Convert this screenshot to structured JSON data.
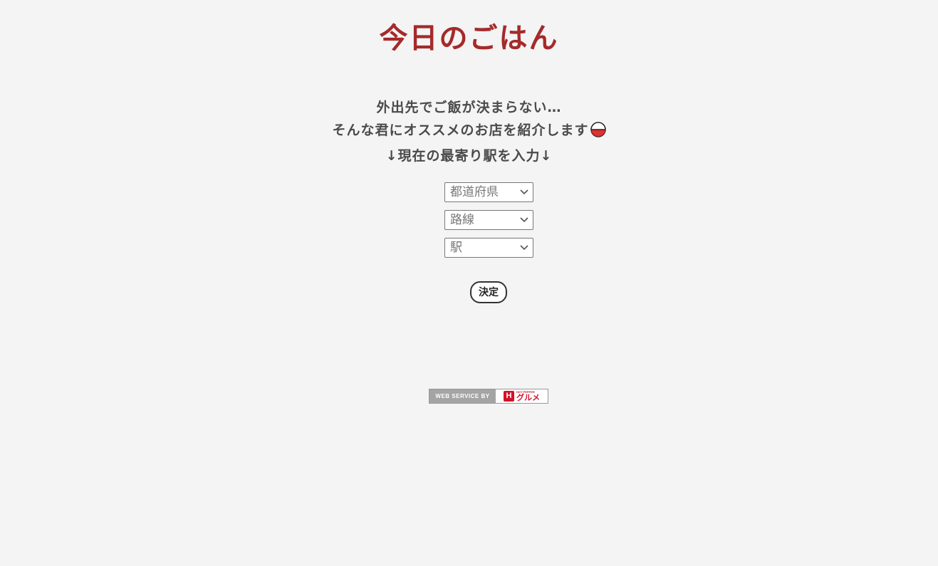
{
  "header": {
    "title": "今日のごはん"
  },
  "intro": {
    "line1": "外出先でご飯が決まらない…",
    "line2": "そんな君にオススメのお店を紹介します",
    "line3": "↓現在の最寄り駅を入力↓"
  },
  "form": {
    "prefecture_placeholder": "都道府県",
    "line_placeholder": "路線",
    "station_placeholder": "駅",
    "submit_label": "決定"
  },
  "credit": {
    "left_text": "WEB SERVICE BY",
    "brand_small": "HOT PEPPER",
    "brand_big": "グルメ",
    "logo_letter": "H"
  },
  "colors": {
    "title": "#a52a2a",
    "background": "#f4f4f4",
    "brand": "#d3122a"
  }
}
